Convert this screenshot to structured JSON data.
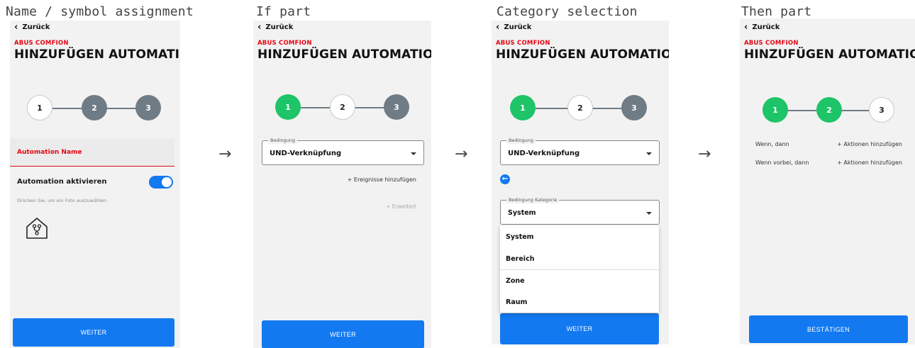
{
  "captions": {
    "c1": "Name / symbol assignment",
    "c2": "If part",
    "c3": "Category selection",
    "c4": "Then part"
  },
  "arrows": {
    "glyph": "→"
  },
  "common": {
    "back_label": "Zurück",
    "brand": "ABUS COMFION",
    "title": "HINZUFÜGEN AUTOMATION",
    "steps": [
      "1",
      "2",
      "3"
    ]
  },
  "screen1": {
    "name_field_label": "Automation Name",
    "toggle_label": "Automation aktivieren",
    "toggle_state": "on",
    "photo_hint": "Drücken Sie, um ein Foto auszuwählen",
    "icon": "house-network-icon",
    "next_button": "WEITER"
  },
  "screen2": {
    "condition_legend": "Bedingung",
    "condition_value": "UND-Verknüpfung",
    "add_events": "+ Ereignisse hinzufügen",
    "extended": "+ Erweitert",
    "next_button": "WEITER"
  },
  "screen3": {
    "condition_legend": "Bedingung",
    "condition_value": "UND-Verknüpfung",
    "category_legend": "Bedingung Kategorie",
    "category_value": "System",
    "menu_items": [
      "System",
      "Bereich",
      "Zone",
      "Raum"
    ],
    "next_button": "WEITER"
  },
  "screen4": {
    "row1_label": "Wenn, dann",
    "row1_action": "+ Aktionen hinzufügen",
    "row2_label": "Wenn vorbei, dann",
    "row2_action": "+ Aktionen hinzufügen",
    "confirm_button": "BESTÄTIGEN"
  },
  "colors": {
    "accent_blue": "#1379f1",
    "brand_red": "#e30613",
    "step_green": "#1ec468",
    "step_gray": "#6f7b85",
    "panel_bg": "#f2f2f2"
  }
}
